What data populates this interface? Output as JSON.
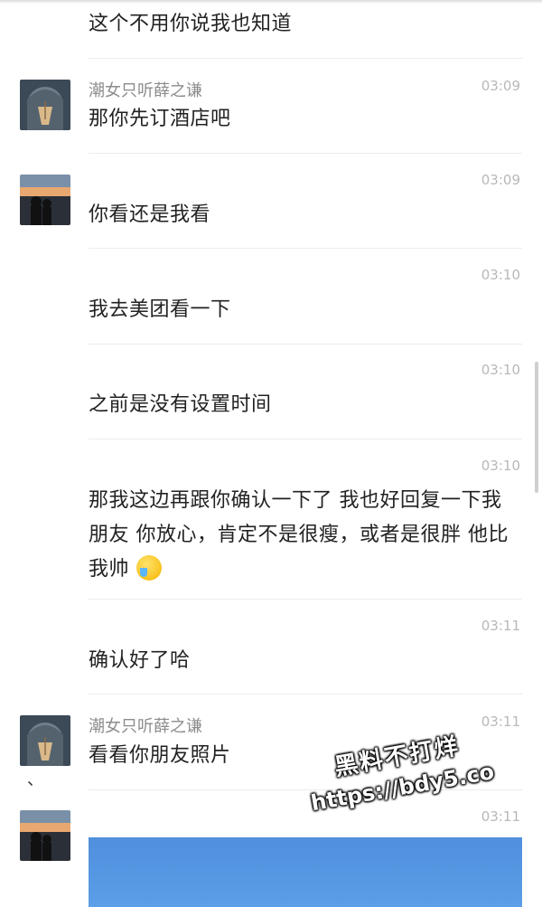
{
  "contacts": {
    "her": {
      "name": "潮女只听薛之谦"
    }
  },
  "messages": [
    {
      "text": "这个不用你说我也知道"
    },
    {
      "name": "潮女只听薛之谦",
      "time": "03:09",
      "text": "那你先订酒店吧"
    },
    {
      "time": "03:09",
      "text": "你看还是我看"
    },
    {
      "time": "03:10",
      "text": "我去美团看一下"
    },
    {
      "time": "03:10",
      "text": "之前是没有设置时间"
    },
    {
      "time": "03:10",
      "text": "那我这边再跟你确认一下了  我也好回复一下我朋友 你放心，肯定不是很瘦，或者是很胖   他比我帅"
    },
    {
      "time": "03:11",
      "text": "确认好了哈"
    },
    {
      "name": "潮女只听薛之谦",
      "time": "03:11",
      "text": "看看你朋友照片"
    },
    {
      "time": "03:11"
    }
  ],
  "extra": {
    "tick_mark": "、"
  },
  "watermark": {
    "line1": "黑料不打烊",
    "line2": "https://bdy5.co"
  },
  "colors": {
    "name": "#8c8c8c",
    "time": "#b8b8b8",
    "divider": "#ececec",
    "image_sky": "#5c9ee8"
  }
}
